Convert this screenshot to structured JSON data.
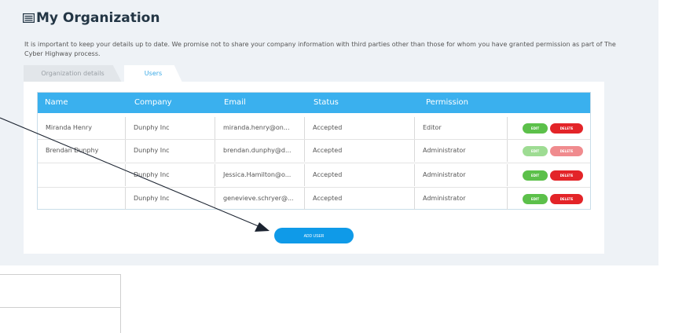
{
  "page": {
    "title": "My Organization",
    "description": "It is important to keep your details up to date. We promise not to share your company information with third parties other than those for whom you have granted permission as part of The Cyber Highway process."
  },
  "tabs": [
    {
      "label": "Organization details",
      "active": false
    },
    {
      "label": "Users",
      "active": true
    }
  ],
  "table": {
    "headers": [
      "Name",
      "Company",
      "Email",
      "Status",
      "Permission"
    ],
    "rows": [
      {
        "name": "Miranda Henry",
        "company": "Dunphy Inc",
        "email": "miranda.henry@on...",
        "status": "Accepted",
        "permission": "Editor",
        "edit": "EDIT",
        "delete": "DELETE"
      },
      {
        "name": "Brendan Dunphy",
        "company": "Dunphy Inc",
        "email": "brendan.dunphy@d...",
        "status": "Accepted",
        "permission": "Administrator",
        "edit": "EDIT",
        "delete": "DELETE"
      },
      {
        "name": "",
        "company": "Dunphy Inc",
        "email": "Jessica.Hamilton@o...",
        "status": "Accepted",
        "permission": "Administrator",
        "edit": "EDIT",
        "delete": "DELETE"
      },
      {
        "name": "",
        "company": "Dunphy Inc",
        "email": "genevieve.schryer@...",
        "status": "Accepted",
        "permission": "Administrator",
        "edit": "EDIT",
        "delete": "DELETE"
      }
    ]
  },
  "actions": {
    "add_user": "ADD USER"
  },
  "colors": {
    "accent": "#3ab0ee",
    "edit": "#5cc04a",
    "delete": "#e32428",
    "title": "#233645"
  },
  "icons": {
    "title": "list-card-icon",
    "annotation": "arrow-pointer"
  }
}
